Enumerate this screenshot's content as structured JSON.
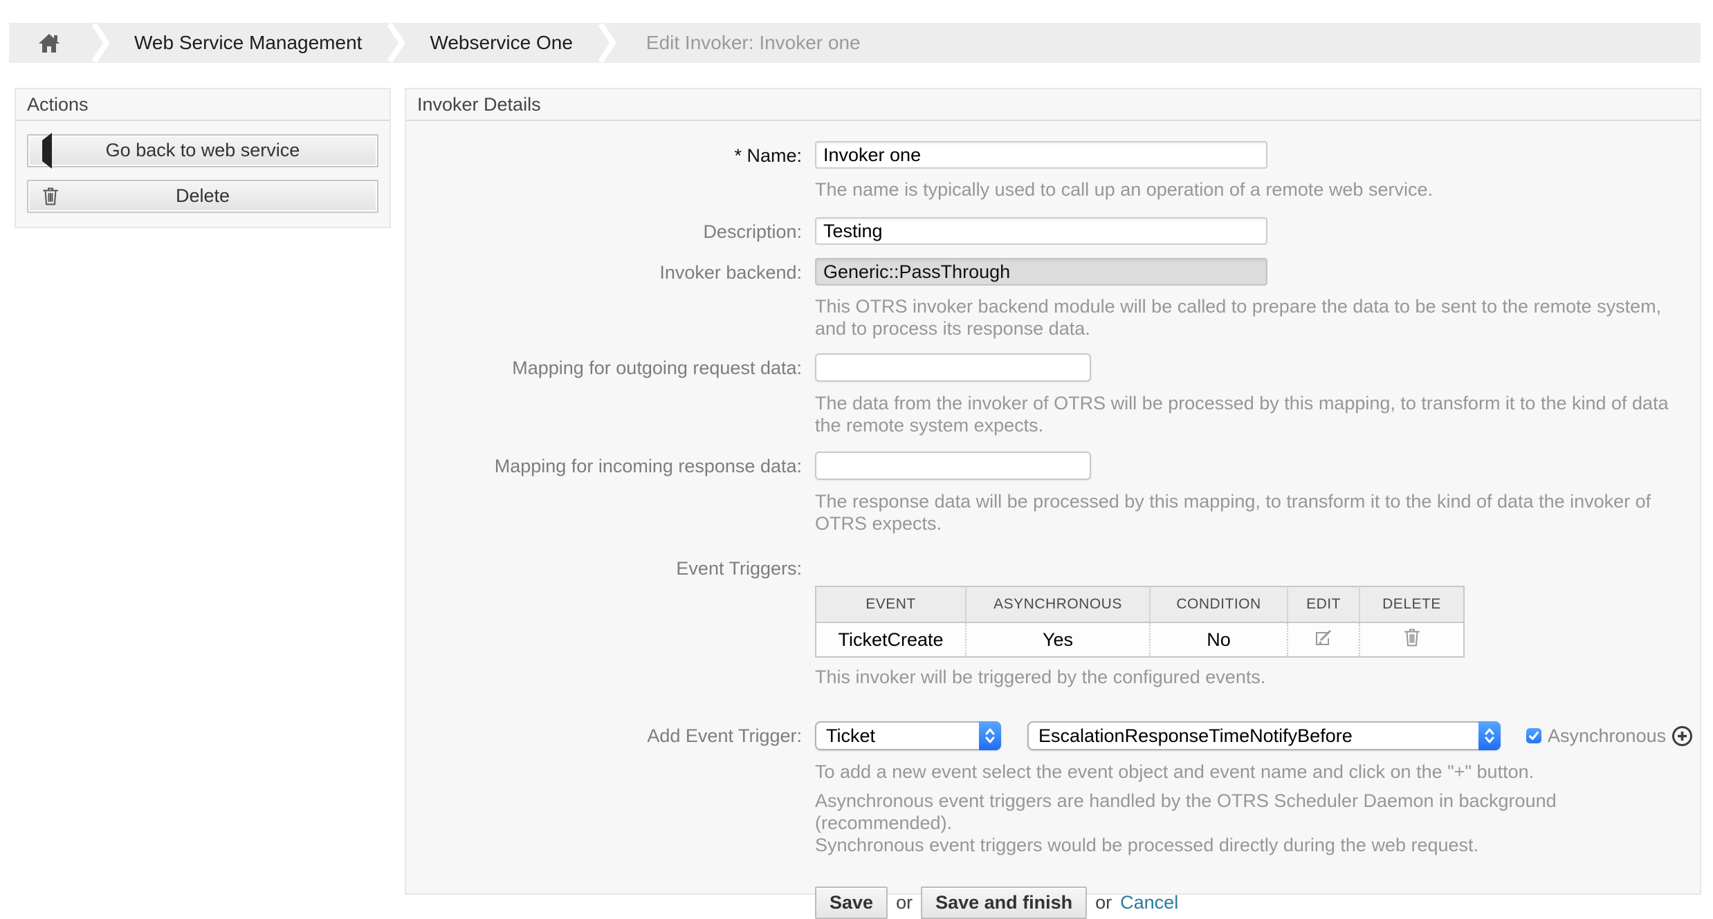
{
  "breadcrumb": {
    "items": [
      "Web Service Management",
      "Webservice One",
      "Edit Invoker: Invoker one"
    ]
  },
  "sidebar": {
    "title": "Actions",
    "go_back_label": "Go back to web service",
    "delete_label": "Delete"
  },
  "main": {
    "title": "Invoker Details",
    "required_marker": "*",
    "fields": {
      "name": {
        "label": "Name:",
        "value": "Invoker one",
        "hint": "The name is typically used to call up an operation of a remote web service."
      },
      "description": {
        "label": "Description:",
        "value": "Testing"
      },
      "backend": {
        "label": "Invoker backend:",
        "value": "Generic::PassThrough",
        "hint": "This OTRS invoker backend module will be called to prepare the data to be sent to the remote system, and to process its response data."
      },
      "mapping_outgoing": {
        "label": "Mapping for outgoing request data:",
        "value": "",
        "hint": "The data from the invoker of OTRS will be processed by this mapping, to transform it to the kind of data the remote system expects."
      },
      "mapping_incoming": {
        "label": "Mapping for incoming response data:",
        "value": "",
        "hint": "The response data will be processed by this mapping, to transform it to the kind of data the invoker of OTRS expects."
      }
    },
    "event_triggers": {
      "label": "Event Triggers:",
      "headers": [
        "EVENT",
        "ASYNCHRONOUS",
        "CONDITION",
        "EDIT",
        "DELETE"
      ],
      "rows": [
        {
          "event": "TicketCreate",
          "asynchronous": "Yes",
          "condition": "No"
        }
      ],
      "hint": "This invoker will be triggered by the configured events."
    },
    "add_event_trigger": {
      "label": "Add Event Trigger:",
      "object_value": "Ticket",
      "event_value": "EscalationResponseTimeNotifyBefore",
      "asynchronous_label": "Asynchronous",
      "asynchronous_checked": true,
      "hint": "To add a new event select the event object and event name and click on the \"+\" button.",
      "note_line1": "Asynchronous event triggers are handled by the OTRS Scheduler Daemon in background (recommended).",
      "note_line2": "Synchronous event triggers would be processed directly during the web request."
    },
    "footer": {
      "save": "Save",
      "or": "or",
      "save_and_finish": "Save and finish",
      "cancel": "Cancel"
    }
  }
}
